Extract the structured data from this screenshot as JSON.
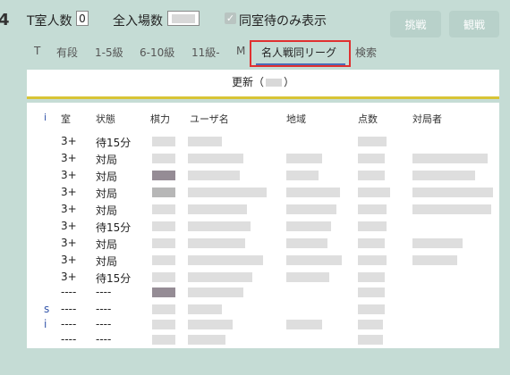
{
  "edge": {
    "left_char": "4"
  },
  "header": {
    "t_room_label": "T室人数",
    "t_room_count": "0",
    "total_venues_label": "全入場数",
    "same_room_waiting_label": "同室待のみ表示",
    "challenge_button": "挑戦",
    "watch_button": "観戦"
  },
  "tabs": [
    {
      "label": "T"
    },
    {
      "label": "有段"
    },
    {
      "label": "1-5級"
    },
    {
      "label": "6-10級"
    },
    {
      "label": "11級-"
    },
    {
      "label": "M"
    },
    {
      "label": "名人戦同リーグ",
      "active": true
    },
    {
      "label": "検索"
    }
  ],
  "refresh": {
    "prefix": "更新（",
    "suffix": "）"
  },
  "table": {
    "columns": [
      "i",
      "室",
      "状態",
      "棋力",
      "ユーザ名",
      "地域",
      "点数",
      "対局者"
    ],
    "rows": [
      {
        "mark": "",
        "room": "3+",
        "status": "待15分"
      },
      {
        "mark": "",
        "room": "3+",
        "status": "対局"
      },
      {
        "mark": "",
        "room": "3+",
        "status": "対局"
      },
      {
        "mark": "",
        "room": "3+",
        "status": "対局"
      },
      {
        "mark": "",
        "room": "3+",
        "status": "対局"
      },
      {
        "mark": "",
        "room": "3+",
        "status": "待15分"
      },
      {
        "mark": "",
        "room": "3+",
        "status": "対局"
      },
      {
        "mark": "",
        "room": "3+",
        "status": "対局"
      },
      {
        "mark": "",
        "room": "3+",
        "status": "待15分"
      },
      {
        "mark": "",
        "room": "----",
        "status": "----"
      },
      {
        "mark": "s",
        "room": "----",
        "status": "----"
      },
      {
        "mark": "i",
        "room": "----",
        "status": "----"
      },
      {
        "mark": "",
        "room": "----",
        "status": "----"
      }
    ]
  },
  "colors": {
    "background": "#c5dcd5",
    "button": "#b8d1ca",
    "active_tab_underline": "#4b6cb7",
    "highlight_box": "#e03030",
    "refresh_underline": "#d8c436"
  }
}
